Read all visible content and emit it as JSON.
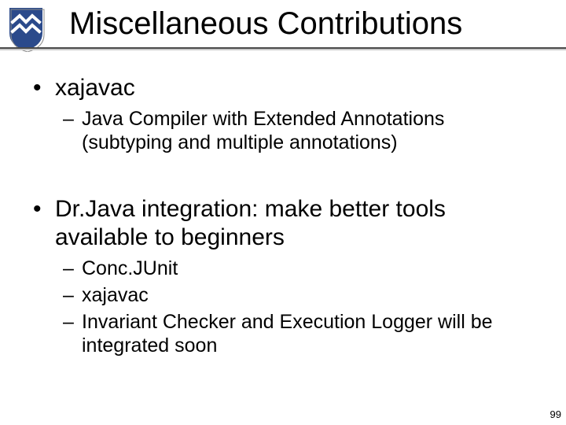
{
  "title": "Miscellaneous Contributions",
  "bullets": {
    "b1": "xajavac",
    "b1_1": "Java Compiler with Extended Annotations (subtyping and multiple annotations)",
    "b2": "Dr.Java integration: make better tools available to beginners",
    "b2_1": "Conc.JUnit",
    "b2_2": "xajavac",
    "b2_3": "Invariant Checker and Execution Logger will be integrated soon"
  },
  "page_number": "99",
  "logo": {
    "name": "shield-logo",
    "bg": "#2b4a8b",
    "fg": "#ffffff",
    "shadow": "#8a8a8a"
  }
}
